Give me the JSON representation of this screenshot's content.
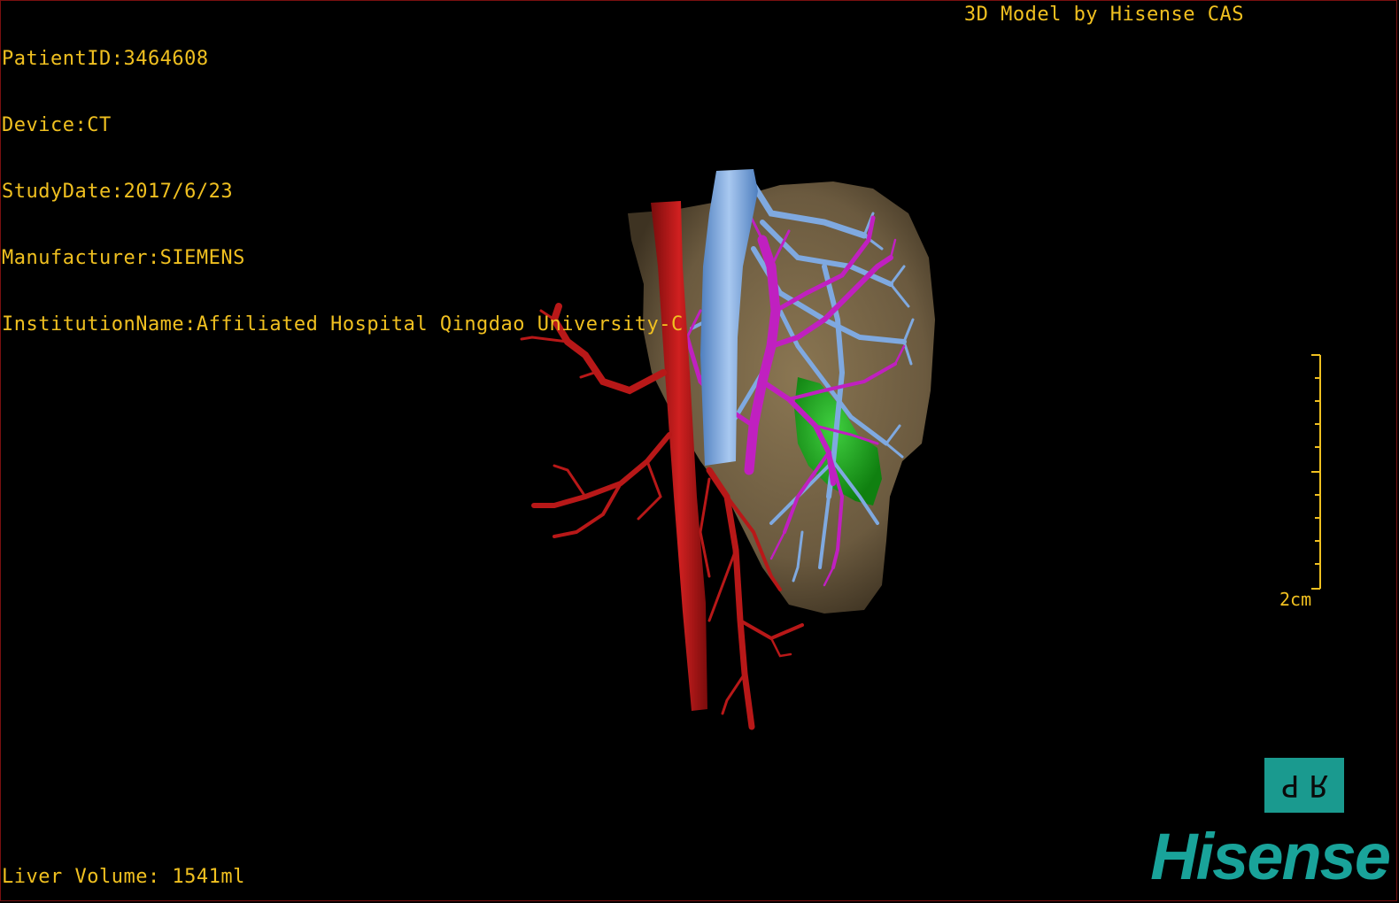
{
  "overlay": {
    "patient_id": "PatientID:3464608",
    "device": "Device:CT",
    "study_date": "StudyDate:2017/6/23",
    "manufacturer": "Manufacturer:SIEMENS",
    "institution": "InstitutionName:Affiliated Hospital Qingdao University-C",
    "credit": "3D Model by Hisense CAS",
    "liver_volume": "Liver Volume: 1541ml"
  },
  "scale_bar": {
    "label": "2cm"
  },
  "orientation_cube": {
    "left_glyph": "P",
    "right_glyph": "R"
  },
  "logo": {
    "text": "Hisense"
  },
  "colors": {
    "text": "#f0c020",
    "liver": "#6b5a3f",
    "artery": "#b01818",
    "portal_vein": "#c020c0",
    "hepatic_vein": "#6f9fdc",
    "lesion": "#20a020",
    "brand": "#19a39a"
  }
}
